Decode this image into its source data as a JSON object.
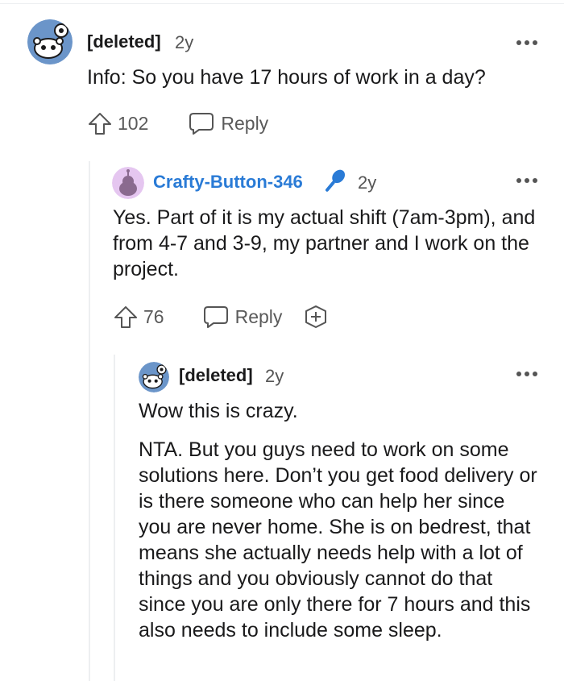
{
  "comments": [
    {
      "author": "[deleted]",
      "age": "2y",
      "body": [
        "Info: So you have 17 hours of work in a day?"
      ],
      "votes": "102",
      "reply_label": "Reply",
      "avatar_icon": "snoo-deleted-avatar-icon"
    },
    {
      "author": "Crafty-Button-346",
      "author_color": "#2a7bd6",
      "flair_icon": "microphone-icon",
      "age": "2y",
      "body": [
        "Yes. Part of it is my actual shift (7am-3pm), and from 4-7 and 3-9, my partner and I work on the project."
      ],
      "votes": "76",
      "reply_label": "Reply",
      "avatar_icon": "snoo-purple-avatar-icon",
      "award_icon": "add-award-icon"
    },
    {
      "author": "[deleted]",
      "age": "2y",
      "body": [
        "Wow this is crazy.",
        "NTA. But you guys need to work on some solutions here. Don’t you get food delivery or is there someone who can help her since you are never home. She is on bedrest, that means she actually needs help with a lot of things and you obviously cannot do that since you are only there for 7 hours and this also needs to include some sleep."
      ],
      "avatar_icon": "snoo-deleted-avatar-icon"
    }
  ],
  "colors": {
    "accent": "#2a7bd6",
    "meta": "#555555",
    "thread_line": "#edeff1"
  }
}
